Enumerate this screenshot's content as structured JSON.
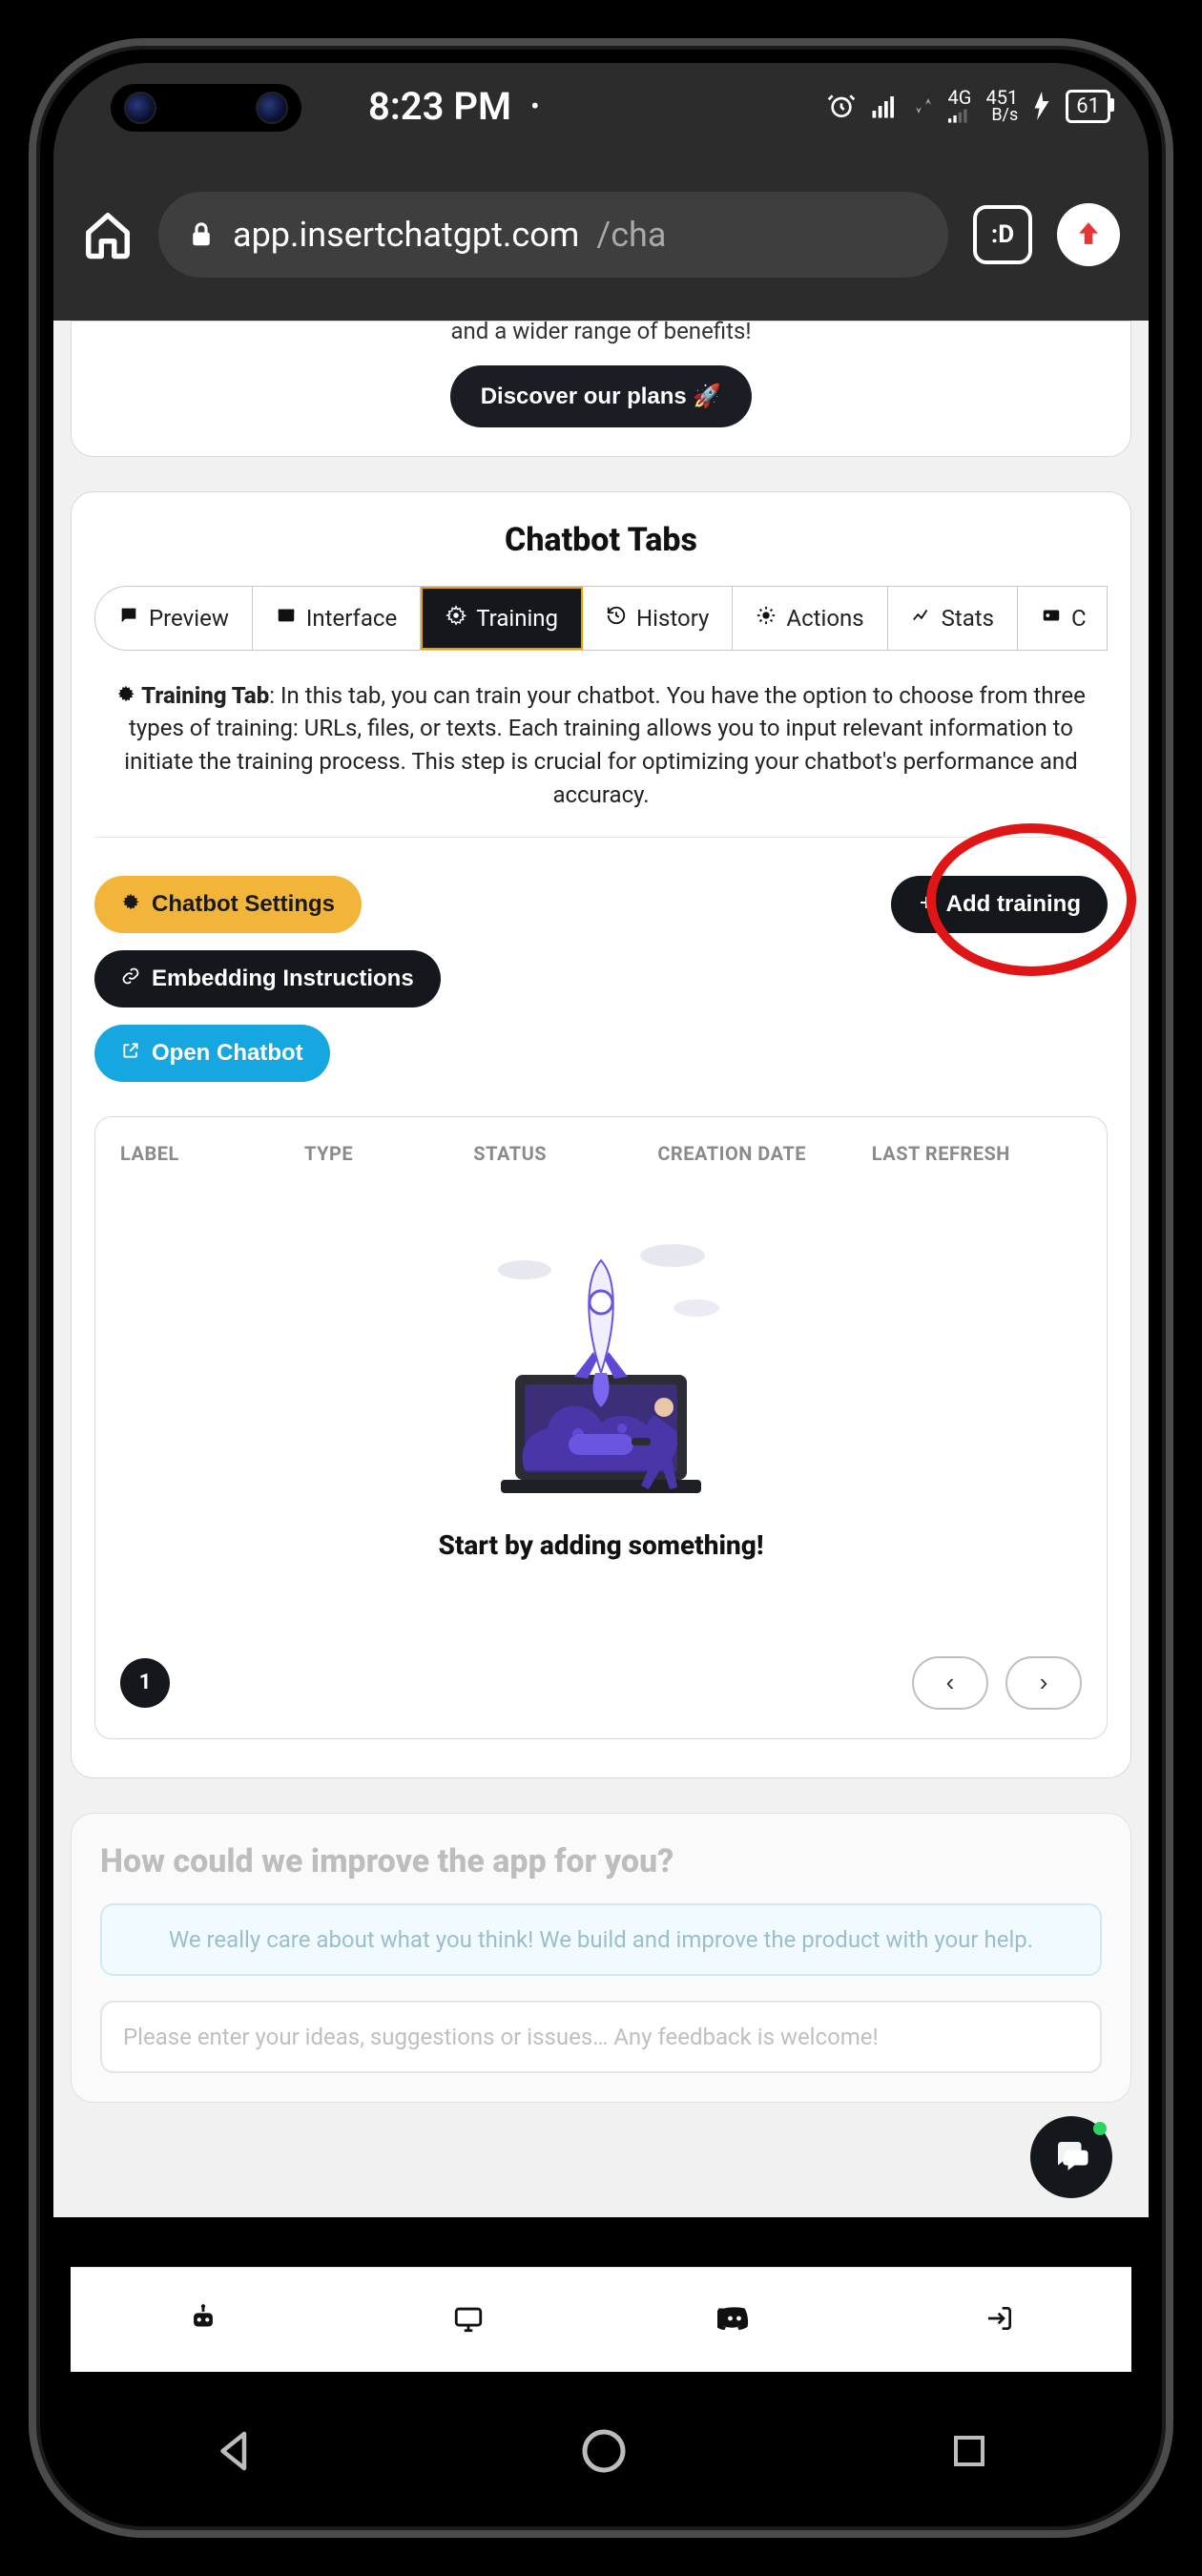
{
  "status": {
    "time": "8:23 PM",
    "net_label": "4G",
    "rate_top": "451",
    "rate_bottom": "B/s",
    "battery": "61"
  },
  "browser": {
    "host": "app.insertchatgpt.com",
    "path": "/cha",
    "tabs_badge": ":D"
  },
  "upgrade": {
    "tail": "and a wider range of benefits!",
    "cta": "Discover our plans 🚀"
  },
  "tabs_card": {
    "title": "Chatbot Tabs",
    "tabs": [
      {
        "label": "Preview"
      },
      {
        "label": "Interface"
      },
      {
        "label": "Training"
      },
      {
        "label": "History"
      },
      {
        "label": "Actions"
      },
      {
        "label": "Stats"
      },
      {
        "label": "C"
      }
    ],
    "help_title": "Training Tab",
    "help_body": ": In this tab, you can train your chatbot. You have the option to choose from three types of training: URLs, files, or texts. Each training allows you to input relevant information to initiate the training process. This step is crucial for optimizing your chatbot's performance and accuracy.",
    "buttons": {
      "settings": "Chatbot Settings",
      "embed": "Embedding Instructions",
      "open": "Open Chatbot",
      "add": "Add training"
    },
    "table": {
      "headers": {
        "label": "LABEL",
        "type": "TYPE",
        "status": "STATUS",
        "created": "CREATION DATE",
        "refresh": "LAST REFRESH"
      },
      "empty": "Start by adding something!"
    },
    "page_num": "1"
  },
  "feedback": {
    "title": "How could we improve the app for you?",
    "banner": "We really care about what you think! We build and improve the product with your help.",
    "placeholder": "Please enter your ideas, suggestions or issues… Any feedback is welcome!"
  }
}
